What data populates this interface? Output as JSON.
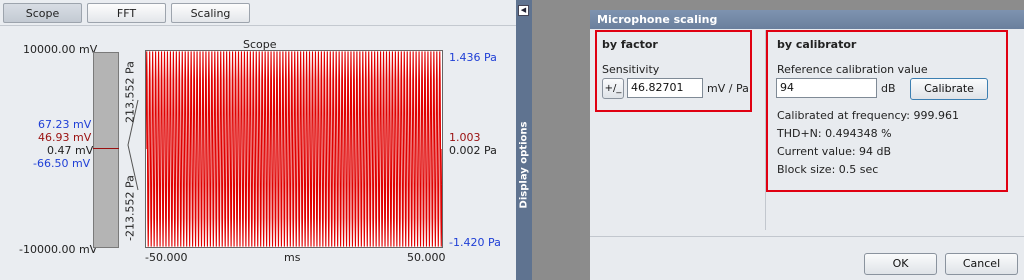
{
  "tabs": [
    {
      "label": "Scope",
      "active": true
    },
    {
      "label": "FFT",
      "active": false
    },
    {
      "label": "Scaling",
      "active": false
    }
  ],
  "scope": {
    "left_axis": {
      "top": "10000.00 mV",
      "bottom": "-10000.00 mV"
    },
    "readouts": {
      "max_mv": "67.23 mV",
      "red_mv": "46.93 mV",
      "current_mv": "0.47 mV",
      "min_mv": "-66.50 mV"
    },
    "bar_labels": {
      "top_pa": "213.552 Pa",
      "bottom_pa": "-213.552 Pa"
    },
    "right_axis": {
      "top_pa": "1.436 Pa",
      "ratio": "1.003",
      "current_pa": "0.002 Pa",
      "bottom_pa": "-1.420 Pa"
    },
    "marker_color": "#9a1010"
  },
  "side_panel": {
    "label": "Display options",
    "collapse_icon": "arrow-left-icon"
  },
  "dialog": {
    "title": "Microphone scaling",
    "by_factor": {
      "heading": "by factor",
      "sensitivity_label": "Sensitivity",
      "sign_button": "+/_",
      "sensitivity_value": "46.82701",
      "unit": "mV / Pa"
    },
    "by_calibrator": {
      "heading": "by calibrator",
      "reference_label": "Reference calibration value",
      "reference_value": "94",
      "reference_unit": "dB",
      "calibrate_button": "Calibrate",
      "calibrated_at": "Calibrated at frequency: 999.961",
      "thd": "THD+N: 0.494348 %",
      "current_value": "Current value: 94 dB",
      "block_size": "Block size: 0.5 sec"
    },
    "ok_button": "OK",
    "cancel_button": "Cancel"
  },
  "colors": {
    "highlight_box": "#e00012",
    "waveform": "#e00000",
    "titlebar": "#6f84a2"
  },
  "chart_data": {
    "type": "line",
    "title": "Scope",
    "xlabel": "ms",
    "x_ticks": [
      "-50.000",
      "50.000"
    ],
    "xlim": [
      -50,
      50
    ],
    "ylim": [
      -1.436,
      1.436
    ],
    "carrier_frequency_hz": 1000,
    "amplitude_pa": 1.43,
    "series": [
      {
        "values": []
      }
    ]
  }
}
